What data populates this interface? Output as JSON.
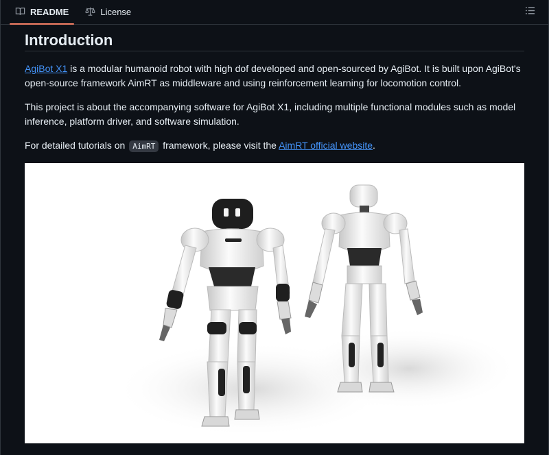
{
  "tabs": {
    "readme": "README",
    "license": "License"
  },
  "content": {
    "heading": "Introduction",
    "p1_link": "AgiBot X1",
    "p1_rest": " is a modular humanoid robot with high dof developed and open-sourced by AgiBot. It is built upon AgiBot's open-source framework AimRT as middleware and using reinforcement learning for locomotion control.",
    "p2": "This project is about the accompanying software for AgiBot X1, including multiple functional modules such as model inference, platform driver, and software simulation.",
    "p3_before": "For detailed tutorials on ",
    "p3_code": "AimRT",
    "p3_middle": " framework, please visit the ",
    "p3_link": "AimRT official website",
    "p3_after": "."
  },
  "icons": {
    "readme": "book-icon",
    "license": "law-scale-icon",
    "outline": "list-outline-icon"
  },
  "colors": {
    "background": "#0d1117",
    "text": "#e6edf3",
    "link": "#4493f8",
    "active_tab_underline": "#f78166",
    "border": "#30363d"
  }
}
